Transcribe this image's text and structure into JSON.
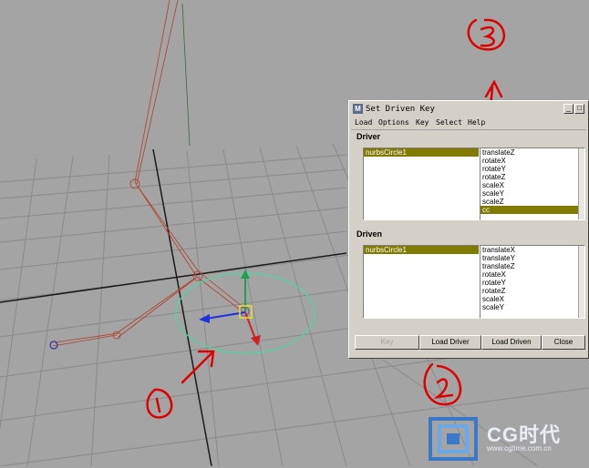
{
  "window": {
    "title": "Set Driven Key",
    "icon": "maya-icon"
  },
  "menu": [
    "Load",
    "Options",
    "Key",
    "Select",
    "Help"
  ],
  "driver": {
    "label": "Driver",
    "objects": [
      "nurbsCircle1"
    ],
    "selected_object": "nurbsCircle1",
    "attributes": [
      "translateZ",
      "rotateX",
      "rotateY",
      "rotateZ",
      "scaleX",
      "scaleY",
      "scaleZ",
      "cc"
    ],
    "selected_attribute": "cc"
  },
  "driven": {
    "label": "Driven",
    "objects": [
      "nurbsCircle1"
    ],
    "selected_object": "nurbsCircle1",
    "attributes": [
      "translateX",
      "translateY",
      "translateZ",
      "rotateX",
      "rotateY",
      "rotateZ",
      "scaleX",
      "scaleY"
    ]
  },
  "buttons": {
    "key": "Key",
    "load_driver": "Load Driver",
    "load_driven": "Load Driven",
    "close": "Close"
  },
  "annotations": {
    "one": "①",
    "two": "②",
    "three": "③"
  },
  "watermark": {
    "brand": "CG时代",
    "url": "www.cgtime.com.cn"
  },
  "colors": {
    "viewport_bg": "#a4a4a4",
    "selection": "#807a00",
    "annotation": "#e00000",
    "circle": "#4ad9a0"
  }
}
